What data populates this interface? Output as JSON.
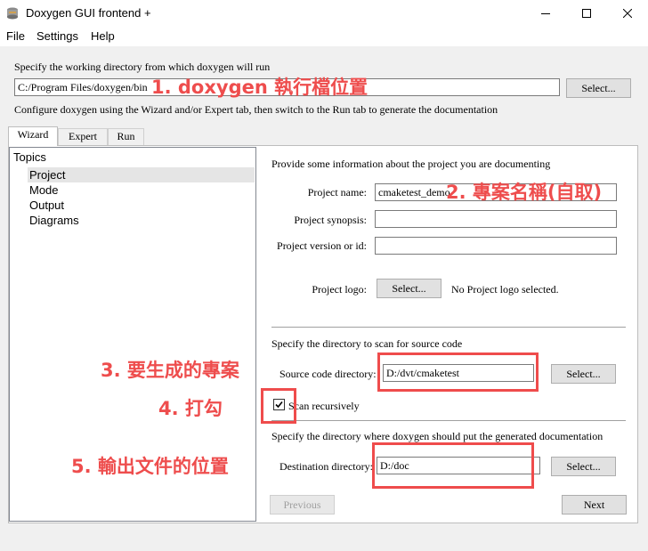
{
  "window": {
    "title": "Doxygen GUI frontend +"
  },
  "menu": {
    "items": [
      "File",
      "Settings",
      "Help"
    ]
  },
  "workdir": {
    "hint": "Specify the working directory from which doxygen will run",
    "value": "C:/Program Files/doxygen/bin",
    "select_label": "Select...",
    "configure_hint": "Configure doxygen using the Wizard and/or Expert tab, then switch to the Run tab to generate the documentation"
  },
  "tabs": [
    "Wizard",
    "Expert",
    "Run"
  ],
  "topics": {
    "heading": "Topics",
    "items": [
      "Project",
      "Mode",
      "Output",
      "Diagrams"
    ],
    "selected": "Project"
  },
  "project": {
    "intro": "Provide some information about the project you are documenting",
    "name_label": "Project name:",
    "name_value": "cmaketest_demo",
    "synopsis_label": "Project synopsis:",
    "synopsis_value": "",
    "version_label": "Project version or id:",
    "version_value": "",
    "logo_label": "Project logo:",
    "logo_select_label": "Select...",
    "logo_status": "No Project logo selected."
  },
  "source": {
    "heading": "Specify the directory to scan for source code",
    "dir_label": "Source code directory:",
    "dir_value": "D:/dvt/cmaketest",
    "select_label": "Select...",
    "recursive_label": "Scan recursively",
    "recursive_checked": true
  },
  "destination": {
    "heading": "Specify the directory where doxygen should put the generated documentation",
    "dir_label": "Destination directory:",
    "dir_value": "D:/doc",
    "select_label": "Select..."
  },
  "nav": {
    "previous_label": "Previous",
    "next_label": "Next"
  },
  "annotations": {
    "a1": "1. doxygen 執行檔位置",
    "a2": "2. 專案名稱(自取)",
    "a3": "3. 要生成的專案",
    "a4": "4. 打勾",
    "a5": "5. 輸出文件的位置"
  },
  "colors": {
    "annotation": "#ee4d4d",
    "selection": "#e5e5e5"
  }
}
